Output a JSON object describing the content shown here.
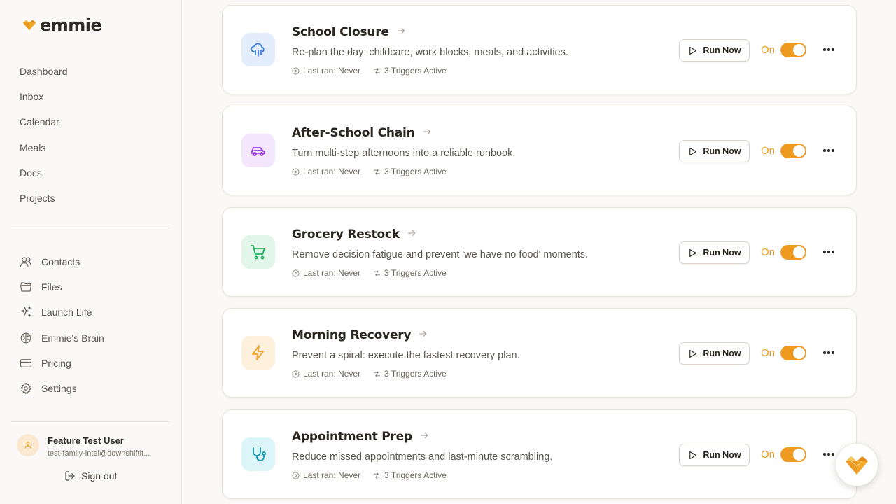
{
  "brand": {
    "name": "emmie",
    "accent": "#ef9b22"
  },
  "sidebar": {
    "primary": [
      {
        "label": "Dashboard"
      },
      {
        "label": "Inbox"
      },
      {
        "label": "Calendar"
      },
      {
        "label": "Meals"
      },
      {
        "label": "Docs"
      },
      {
        "label": "Projects"
      }
    ],
    "secondary": [
      {
        "label": "Contacts",
        "icon": "users-icon"
      },
      {
        "label": "Files",
        "icon": "folder-icon"
      },
      {
        "label": "Launch Life",
        "icon": "sparkles-icon"
      },
      {
        "label": "Emmie's Brain",
        "icon": "brain-icon"
      },
      {
        "label": "Pricing",
        "icon": "credit-card-icon"
      },
      {
        "label": "Settings",
        "icon": "gear-icon"
      }
    ],
    "user": {
      "name": "Feature Test User",
      "email": "test-family-intel@downshiftit..."
    },
    "signout_label": "Sign out"
  },
  "routines": [
    {
      "title": "School Closure",
      "description": "Re-plan the day: childcare, work blocks, meals, and activities.",
      "last_ran": "Last ran: Never",
      "triggers": "3 Triggers Active",
      "run_label": "Run Now",
      "status": "On",
      "icon": "cloud-rain-icon",
      "icon_color": "#3f7fe0",
      "icon_bg": "#e3edfc"
    },
    {
      "title": "After-School Chain",
      "description": "Turn multi-step afternoons into a reliable runbook.",
      "last_ran": "Last ran: Never",
      "triggers": "3 Triggers Active",
      "run_label": "Run Now",
      "status": "On",
      "icon": "car-icon",
      "icon_color": "#9333ea",
      "icon_bg": "#f3e6fd"
    },
    {
      "title": "Grocery Restock",
      "description": "Remove decision fatigue and prevent 'we have no food' moments.",
      "last_ran": "Last ran: Never",
      "triggers": "3 Triggers Active",
      "run_label": "Run Now",
      "status": "On",
      "icon": "cart-icon",
      "icon_color": "#22b35e",
      "icon_bg": "#e1f6e8"
    },
    {
      "title": "Morning Recovery",
      "description": "Prevent a spiral: execute the fastest recovery plan.",
      "last_ran": "Last ran: Never",
      "triggers": "3 Triggers Active",
      "run_label": "Run Now",
      "status": "On",
      "icon": "lightning-icon",
      "icon_color": "#f0a028",
      "icon_bg": "#fdf0dc"
    },
    {
      "title": "Appointment Prep",
      "description": "Reduce missed appointments and last-minute scrambling.",
      "last_ran": "Last ran: Never",
      "triggers": "3 Triggers Active",
      "run_label": "Run Now",
      "status": "On",
      "icon": "stethoscope-icon",
      "icon_color": "#0e97b4",
      "icon_bg": "#dcf5f9"
    }
  ]
}
